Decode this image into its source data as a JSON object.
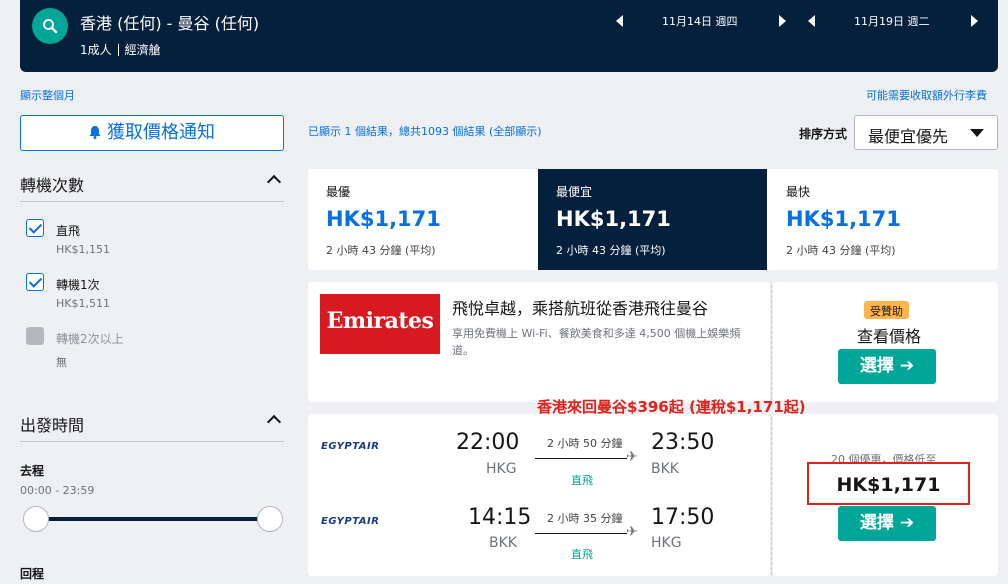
{
  "header": {
    "route": "香港 (任何) - 曼谷 (任何)",
    "passengers": "1成人",
    "cabin": "經濟艙",
    "depart_date": "11月14日 週四",
    "return_date": "11月19日 週二"
  },
  "links": {
    "show_month": "顯示整個月",
    "extra_fees": "可能需要收取額外行李費"
  },
  "sidebar": {
    "price_alert_label": "獲取價格通知",
    "stops_heading": "轉機次數",
    "stops": [
      {
        "label": "直飛",
        "price": "HK$1,151",
        "checked": true,
        "enabled": true
      },
      {
        "label": "轉機1次",
        "price": "HK$1,511",
        "checked": true,
        "enabled": true
      },
      {
        "label": "轉機2次以上",
        "price": "無",
        "checked": false,
        "enabled": false
      }
    ],
    "depart_time_heading": "出發時間",
    "outbound_label": "去程",
    "outbound_range": "00:00 - 23:59",
    "return_label": "回程"
  },
  "results": {
    "count_text": "已顯示 1 個結果，總共1093 個結果 (全部顯示)",
    "sort_label": "排序方式",
    "sort_value": "最便宜優先"
  },
  "tabs": [
    {
      "name": "最優",
      "price": "HK$1,171",
      "duration": "2 小時 43 分鐘 (平均)",
      "active": false
    },
    {
      "name": "最便宜",
      "price": "HK$1,171",
      "duration": "2 小時 43 分鐘 (平均)",
      "active": true
    },
    {
      "name": "最快",
      "price": "HK$1,171",
      "duration": "2 小時 43 分鐘 (平均)",
      "active": false
    }
  ],
  "ad": {
    "logo_text": "Emirates",
    "title": "飛悅卓越，乘搭航班從香港飛往曼谷",
    "description": "享用免費機上 Wi-Fi、餐飲美食和多達 4,500 個機上娛樂頻道。",
    "sponsored": "受贊助",
    "view_price": "查看價格",
    "select_label": "選擇 ➔"
  },
  "promo_text": "香港來回曼谷$396起 (連稅$1,171起)",
  "itinerary": {
    "airline": "EGYPTAIR",
    "outbound": {
      "depart_time": "22:00",
      "depart_code": "HKG",
      "duration": "2 小時 50 分鐘",
      "stops": "直飛",
      "arrive_time": "23:50",
      "arrive_code": "BKK"
    },
    "inbound": {
      "depart_time": "14:15",
      "depart_code": "BKK",
      "duration": "2 小時 35 分鐘",
      "stops": "直飛",
      "arrive_time": "17:50",
      "arrive_code": "HKG"
    },
    "deals_text": "20 個優惠，價格低至",
    "price": "HK$1,171",
    "select_label": "選擇 ➔"
  },
  "colors": {
    "navy": "#05203c",
    "accent_blue": "#0770e3",
    "teal": "#00a698",
    "promo_red": "#e0221b",
    "sponsored_orange": "#ffb54d",
    "emirates_red": "#d71921"
  }
}
